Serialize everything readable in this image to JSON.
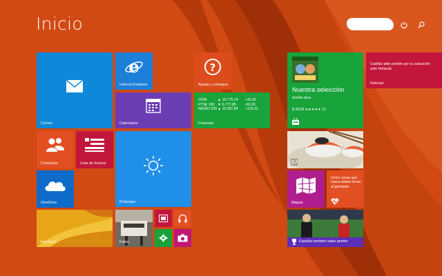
{
  "screen": {
    "title": "Inicio",
    "colors": {
      "background": "#d14a13",
      "swirl_dark": "#a83208",
      "swirl_light": "#e2672a"
    }
  },
  "header": {
    "power_icon": "power-icon",
    "search_icon": "search-icon"
  },
  "tiles": {
    "correo": {
      "label": "Correo",
      "color": "#0f88da",
      "icon": "mail-icon"
    },
    "ie": {
      "label": "Internet Explorer",
      "color": "#1d7fd8",
      "icon": "internet-explorer-icon"
    },
    "calendario": {
      "label": "Calendario",
      "color": "#6a3db3",
      "icon": "calendar-icon"
    },
    "ayuda": {
      "label": "Ayuda y consejos",
      "color": "#dc4c1c",
      "icon": "help-icon"
    },
    "finanzas": {
      "label": "Finanzas",
      "color": "#18a33b",
      "rows": [
        {
          "name": "DOW",
          "value": "▲ 16.775,74",
          "change": "+41,55"
        },
        {
          "name": "FTSE 100",
          "value": "▼ 6.777,85",
          "change": "-65,26"
        },
        {
          "name": "NIKKEI 225",
          "value": "▲ 15.097,84",
          "change": "+124,31"
        }
      ]
    },
    "contactos": {
      "label": "Contactos",
      "color": "#e24f22",
      "icon": "people-icon"
    },
    "lectura": {
      "label": "Lista de lectura",
      "color": "#c3163b",
      "icon": "reading-list-icon"
    },
    "tiempo": {
      "label": "El tiempo",
      "color": "#1f8fe8",
      "icon": "sun-icon"
    },
    "onedrive": {
      "label": "OneDrive",
      "color": "#0f6bc9",
      "icon": "cloud-icon"
    },
    "escritorio": {
      "label": "Escritorio",
      "color": "#e3a21c"
    },
    "fotos": {
      "label": "Fotos"
    },
    "video": {
      "color": "#c3163b",
      "icon": "video-icon"
    },
    "musica": {
      "color": "#e24f22",
      "icon": "headphones-icon"
    },
    "juegos": {
      "color": "#18a33b",
      "icon": "game-controller-icon"
    },
    "camara": {
      "color": "#c01677",
      "icon": "camera-icon"
    },
    "tienda": {
      "color": "#18a33b",
      "heading": "Nuestra selección",
      "app_name": "ilomilo plus",
      "price": "$ 28,99 ★★★★★ 21",
      "icon": "store-icon"
    },
    "noticias_top": {
      "label": "Noticias",
      "color": "#c3163b",
      "headline": "Casillas pide perdón por su actuación ante Holanda"
    },
    "comida": {
      "icon": "food-icon"
    },
    "mapas": {
      "label": "Mapas",
      "color": "#b01e8e",
      "icon": "maps-icon"
    },
    "salud": {
      "color": "#e24f22",
      "headline": "Cinco cosas que nunca debes llevar al gimnasio",
      "icon": "heart-pulse-icon"
    },
    "deportes": {
      "color": "#5c2db8",
      "headline": "España también sabe perder",
      "icon": "trophy-icon"
    }
  }
}
